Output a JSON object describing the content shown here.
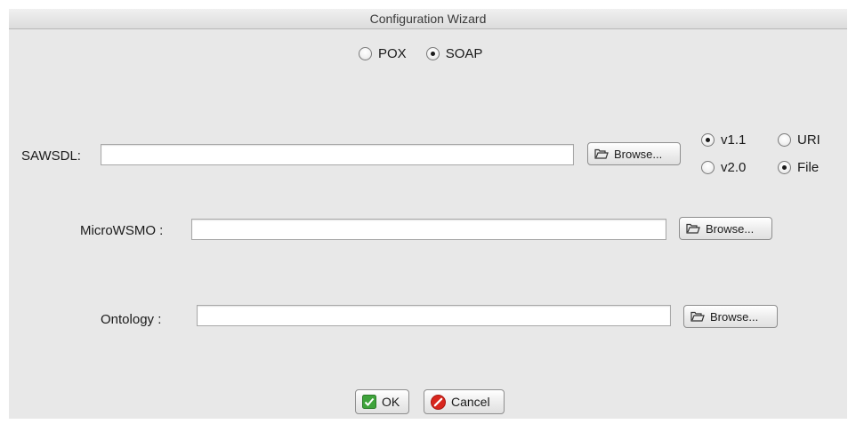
{
  "window": {
    "title": "Configuration Wizard"
  },
  "protocol": {
    "options": [
      {
        "label": "POX",
        "checked": false
      },
      {
        "label": "SOAP",
        "checked": true
      }
    ]
  },
  "sawsdl": {
    "label": "SAWSDL:",
    "value": "",
    "browse_label": "Browse...",
    "versions": [
      {
        "label": "v1.1",
        "checked": true
      },
      {
        "label": "v2.0",
        "checked": false
      }
    ],
    "sources": [
      {
        "label": "URI",
        "checked": false
      },
      {
        "label": "File",
        "checked": true
      }
    ]
  },
  "microwsmo": {
    "label": "MicroWSMO :",
    "value": "",
    "browse_label": "Browse..."
  },
  "ontology": {
    "label": "Ontology :",
    "value": "",
    "browse_label": "Browse..."
  },
  "footer": {
    "ok_label": "OK",
    "cancel_label": "Cancel"
  },
  "colors": {
    "ok_green": "#3fa33b",
    "cancel_red": "#d8261d",
    "window_bg": "#e8e8e8"
  }
}
